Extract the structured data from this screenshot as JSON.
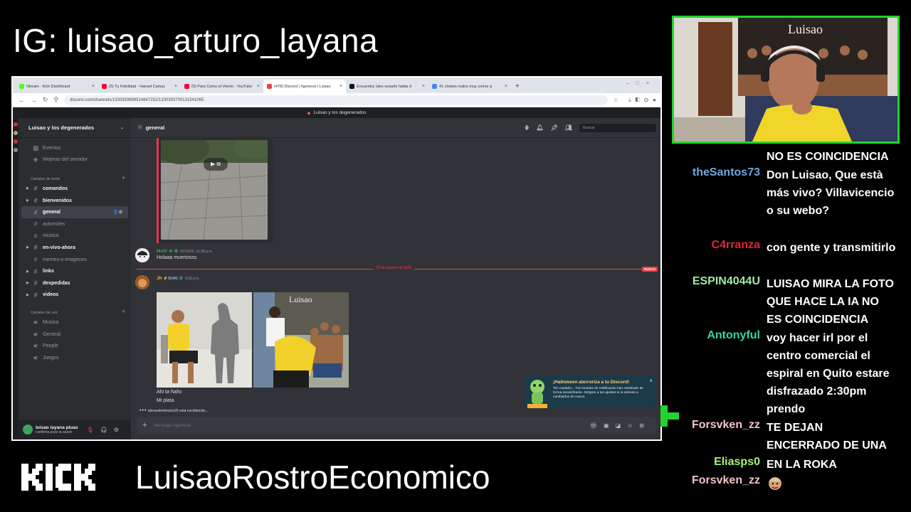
{
  "overlay": {
    "ig_handle": "IG: luisao_arturo_layana",
    "channel_name": "LuisaoRostroEconomico",
    "kick_logo_text": "KICK",
    "cam_poster_text": "Luisao",
    "colors": {
      "green": "#22d32f",
      "background": "#000000"
    }
  },
  "browser": {
    "tabs": [
      {
        "label": "Stream - Kick Dashboard",
        "color": "#53fc18"
      },
      {
        "label": "(5) Tu Fidelidad - Hansel Camac",
        "color": "#ff0033"
      },
      {
        "label": "(5) Para Como el Viento - YouTube",
        "color": "#ff0033"
      },
      {
        "label": "(478) Discord | #general | Luisao",
        "color": "#5865f2"
      },
      {
        "label": "Encuentra 'alex vesarte habla d",
        "color": "#111111"
      },
      {
        "label": "41 chistes malos muy cortos q",
        "color": "#3b8eea"
      }
    ],
    "new_tab": "+",
    "url": "discord.com/channels/1330393699514847252/1330393700131541065"
  },
  "discord": {
    "window_title": "Luisao y los degenerados",
    "server_name": "Luisao y los degenerados",
    "top_items": [
      {
        "label": "Eventos",
        "icon": "calendar-icon"
      },
      {
        "label": "Mejoras del servidor",
        "icon": "boost-icon"
      }
    ],
    "text_category": "Canales de texto",
    "text_channels": [
      {
        "label": "comandos",
        "bold": true
      },
      {
        "label": "bienvenidos",
        "bold": true
      },
      {
        "label": "general",
        "bold": true,
        "selected": true
      },
      {
        "label": "autorroles",
        "bold": false
      },
      {
        "label": "musica",
        "bold": false
      },
      {
        "label": "en-vivo-ahora",
        "bold": true
      },
      {
        "label": "memes-o-imagenes",
        "bold": false
      },
      {
        "label": "links",
        "bold": true
      },
      {
        "label": "despedidas",
        "bold": true
      },
      {
        "label": "videos",
        "bold": true
      }
    ],
    "voice_category": "Canales de voz",
    "voice_channels": [
      "Musica",
      "General",
      "People",
      "Juegos"
    ],
    "user": {
      "name": "luisao layana pluas",
      "status": "confirma pues la sazon"
    },
    "channel_header": "general",
    "search_placeholder": "Buscar",
    "messages": [
      {
        "author": "Mxtl! ★",
        "author_color": "#3ba55d",
        "time": "21/10/25, 10:38 p.m.",
        "text": "Holaaa muertosss"
      },
      {
        "author": "Jh",
        "author_color": "#f0b232",
        "badge": "DUKI",
        "time": "9:03 p.m.",
        "lines": [
          "Ahi ta ñaño",
          "Mi plata"
        ]
      }
    ],
    "date_divider": "29 de octubre de 2025",
    "new_label": "NUEVO",
    "typing": "alexandertenorio25 está escribiendo...",
    "composer_placeholder": "Mensaje #general",
    "toast": {
      "title": "¡Halloween aterroriza a tu Discord!",
      "body": "Ten cuidado... Tus sonidos de notificación han cambiado de forma escalofriante. Dirígete a tus ajustes si te atreves a cambiarlos de nuevo."
    },
    "colors": {
      "bg": "#313338",
      "sidebar": "#2b2d31",
      "accent_red": "#f23f43"
    }
  },
  "chat": {
    "messages": [
      {
        "user": "",
        "user_color": "#ffffff",
        "text": "NO ES COINCIDENCIA"
      },
      {
        "user": "theSantos73",
        "user_color": "#6fa8dc",
        "text": "Don Luisao, Que està más vivo? Villavicencio o su webo?"
      },
      {
        "user": "C4rranza",
        "user_color": "#e0263a",
        "text": "con gente y transmitirlo"
      },
      {
        "user": "ESPIN4044U",
        "user_color": "#9fe7a4",
        "text": "LUISAO MIRA LA FOTO QUE HACE LA IA NO ES COINCIDENCIA"
      },
      {
        "user": "Antonyful",
        "user_color": "#2fd8a0",
        "text": "voy hacer irl por el centro comercial el espiral en Quito estare disfrazado 2:30pm prendo"
      },
      {
        "user": "Forsvken_zz",
        "user_color": "#f4c3c8",
        "text": "TE DEJAN ENCERRADO DE UNA"
      },
      {
        "user": "Eliasps0",
        "user_color": "#a7f07b",
        "text": "EN LA ROKA"
      },
      {
        "user": "Forsvken_zz",
        "user_color": "#f4c3c8",
        "text": "",
        "emote": "emote-icon"
      }
    ]
  }
}
